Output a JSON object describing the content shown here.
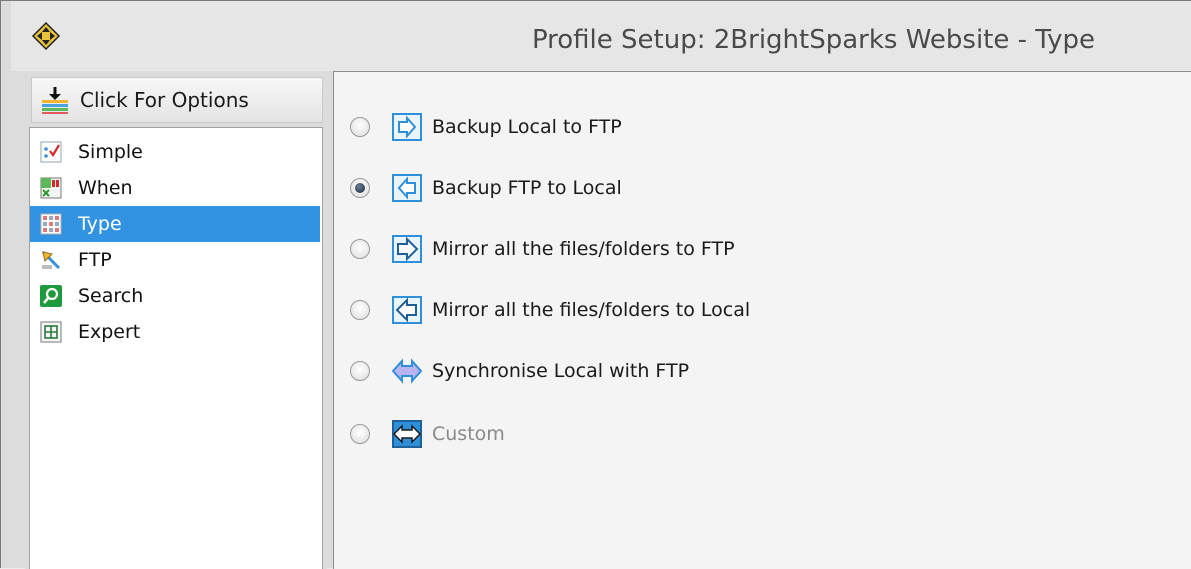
{
  "window": {
    "title": "Profile Setup: 2BrightSparks Website - Type"
  },
  "sidebar": {
    "options_button": {
      "label": "Click For Options",
      "icon": "options-download-icon"
    },
    "items": [
      {
        "label": "Simple",
        "icon": "simple-checklist-icon",
        "selected": false
      },
      {
        "label": "When",
        "icon": "when-calendar-icon",
        "selected": false
      },
      {
        "label": "Type",
        "icon": "type-grid-icon",
        "selected": true
      },
      {
        "label": "FTP",
        "icon": "ftp-icon",
        "selected": false
      },
      {
        "label": "Search",
        "icon": "search-icon",
        "selected": false
      },
      {
        "label": "Expert",
        "icon": "expert-grid-icon",
        "selected": false
      }
    ]
  },
  "type_options": [
    {
      "label": "Backup Local to FTP",
      "checked": false,
      "enabled": true,
      "icon": "backup-to-ftp-icon"
    },
    {
      "label": "Backup FTP to Local",
      "checked": true,
      "enabled": true,
      "icon": "backup-to-local-icon"
    },
    {
      "label": "Mirror all the files/folders to FTP",
      "checked": false,
      "enabled": true,
      "icon": "mirror-to-ftp-icon"
    },
    {
      "label": "Mirror all the files/folders to Local",
      "checked": false,
      "enabled": true,
      "icon": "mirror-to-local-icon"
    },
    {
      "label": "Synchronise Local with FTP",
      "checked": false,
      "enabled": true,
      "icon": "synchronise-icon"
    },
    {
      "label": "Custom",
      "checked": false,
      "enabled": false,
      "icon": "custom-icon"
    }
  ],
  "colors": {
    "selection": "#3393e3",
    "panel": "#f4f4f4",
    "icon_blue": "#2f8fd8"
  }
}
